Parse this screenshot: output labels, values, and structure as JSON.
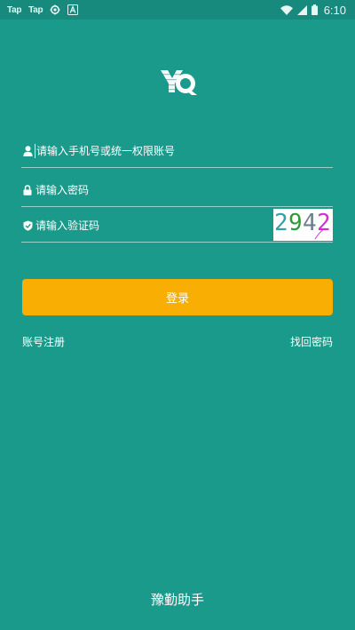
{
  "status_bar": {
    "app_labels": [
      "Tap",
      "Tap"
    ],
    "time": "6:10",
    "icons": [
      "taptap-icon",
      "taptap-icon",
      "settings-icon",
      "text-a-icon",
      "wifi-icon",
      "signal-icon",
      "battery-icon"
    ]
  },
  "logo": {
    "name": "yq-logo"
  },
  "form": {
    "account": {
      "placeholder": "请输入手机号或统一权限账号",
      "value": ""
    },
    "password": {
      "placeholder": "请输入密码",
      "value": ""
    },
    "captcha": {
      "placeholder": "请输入验证码",
      "value": "",
      "code": [
        "2",
        "9",
        "4",
        "2"
      ],
      "code_colors": [
        "#2fa3a8",
        "#2e9b3a",
        "#6b7f8c",
        "#d62bd6"
      ]
    }
  },
  "actions": {
    "login_label": "登录",
    "register_label": "账号注册",
    "forgot_label": "找回密码"
  },
  "footer": {
    "title": "豫勤助手"
  },
  "colors": {
    "background": "#1a9a8b",
    "status_bar": "#188a7d",
    "login_button": "#f8ae02",
    "text": "#ffffff"
  }
}
